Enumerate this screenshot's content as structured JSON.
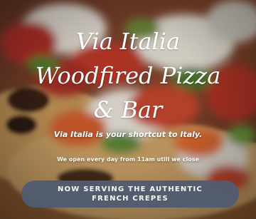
{
  "hero": {
    "title_lines": [
      "Via Italia",
      "Woodfired Pizza",
      "& Bar"
    ],
    "tagline": "Via Italia is your shortcut to Italy.",
    "hours": "We open every day from 11am utill we close",
    "cta_label": "NOW SERVING THE AUTHENTIC FRENCH CREPES",
    "background": "pizza-photo"
  },
  "colors": {
    "cta_background": "#505c70",
    "text": "#ffffff"
  }
}
